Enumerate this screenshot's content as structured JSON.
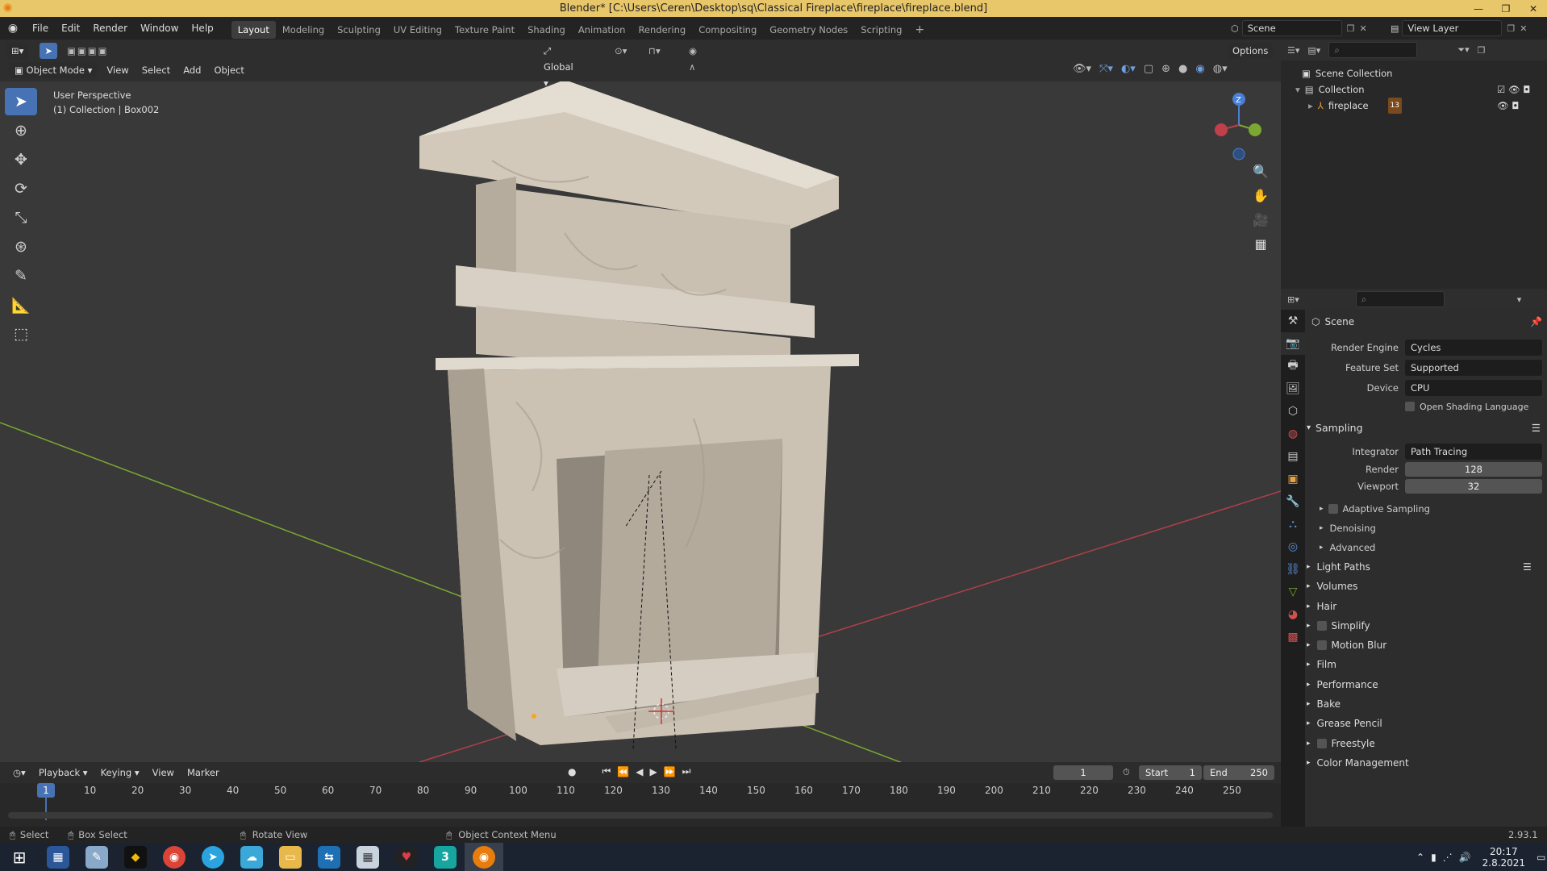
{
  "window": {
    "title": "Blender* [C:\\Users\\Ceren\\Desktop\\sq\\Classical Fireplace\\fireplace\\fireplace.blend]"
  },
  "menu": [
    "File",
    "Edit",
    "Render",
    "Window",
    "Help"
  ],
  "workspaces": [
    "Layout",
    "Modeling",
    "Sculpting",
    "UV Editing",
    "Texture Paint",
    "Shading",
    "Animation",
    "Rendering",
    "Compositing",
    "Geometry Nodes",
    "Scripting"
  ],
  "top_right": {
    "scene": "Scene",
    "view_layer": "View Layer"
  },
  "viewport": {
    "header": {
      "mode": "Object Mode",
      "menus": [
        "View",
        "Select",
        "Add",
        "Object"
      ],
      "transform": "Global",
      "options": "Options"
    },
    "overlay_info": {
      "perspective": "User Perspective",
      "collection": "(1) Collection | Box002"
    },
    "gizmo": {
      "z": "Z"
    }
  },
  "outliner": {
    "scene_collection": "Scene Collection",
    "collection": "Collection",
    "object": "fireplace",
    "object_badge": "13"
  },
  "properties": {
    "context": "Scene",
    "render_engine": {
      "label": "Render Engine",
      "value": "Cycles"
    },
    "feature_set": {
      "label": "Feature Set",
      "value": "Supported"
    },
    "device": {
      "label": "Device",
      "value": "CPU"
    },
    "osl": "Open Shading Language",
    "sampling": {
      "title": "Sampling",
      "integrator_label": "Integrator",
      "integrator": "Path Tracing",
      "render_label": "Render",
      "render": "128",
      "viewport_label": "Viewport",
      "viewport": "32",
      "adaptive": "Adaptive Sampling",
      "denoising": "Denoising",
      "advanced": "Advanced"
    },
    "panels": [
      "Light Paths",
      "Volumes",
      "Hair",
      "Simplify",
      "Motion Blur",
      "Film",
      "Performance",
      "Bake",
      "Grease Pencil",
      "Freestyle",
      "Color Management"
    ]
  },
  "timeline": {
    "menus": [
      "Playback",
      "Keying",
      "View",
      "Marker"
    ],
    "current_frame": "1",
    "start_label": "Start",
    "start": "1",
    "end_label": "End",
    "end": "250",
    "ticks": [
      "1",
      "10",
      "20",
      "30",
      "40",
      "50",
      "60",
      "70",
      "80",
      "90",
      "100",
      "110",
      "120",
      "130",
      "140",
      "150",
      "160",
      "170",
      "180",
      "190",
      "200",
      "210",
      "220",
      "230",
      "240",
      "250"
    ]
  },
  "status": {
    "select": "Select",
    "box_select": "Box Select",
    "rotate": "Rotate View",
    "context_menu": "Object Context Menu",
    "version": "2.93.1"
  },
  "taskbar": {
    "time": "20:17",
    "date": "2.8.2021"
  },
  "colors": {
    "accent": "#4772b3",
    "title_bar": "#e8c66a",
    "x_axis": "#c0404a",
    "y_axis": "#7aa830",
    "z_axis": "#4a7fd6"
  }
}
